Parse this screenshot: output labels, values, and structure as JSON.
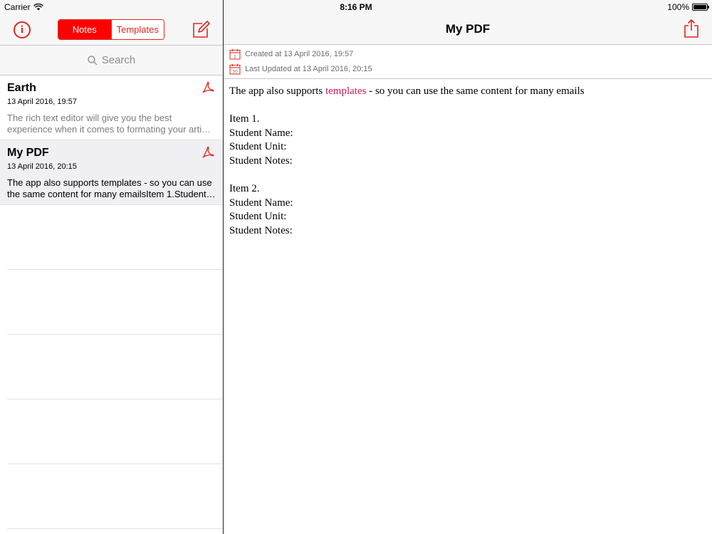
{
  "statusbar": {
    "carrier": "Carrier",
    "time": "8:16 PM",
    "battery": "100%"
  },
  "master": {
    "tabs": [
      {
        "label": "Notes",
        "active": true
      },
      {
        "label": "Templates",
        "active": false
      }
    ],
    "search": {
      "placeholder": "Search"
    },
    "notes": [
      {
        "title": "Earth",
        "date": "13 April 2016, 19:57",
        "preview": "The rich text editor will give you the best experience when it comes to formating your arti…",
        "type_icon": "pdf-icon",
        "selected": false
      },
      {
        "title": "My PDF",
        "date": "13 April 2016, 20:15",
        "preview": "The app also supports templates - so you can use the same content for many emailsItem 1.Student…",
        "type_icon": "pdf-icon",
        "selected": true
      }
    ]
  },
  "detail": {
    "title": "My PDF",
    "created": "Created at 13 April 2016, 19:57",
    "updated": "Last Updated at 13 April 2016, 20:15",
    "content": {
      "intro_before": "The app also supports ",
      "intro_link": "templates",
      "intro_after": " - so you can use the same content for many emails",
      "item1": "Item 1.",
      "item1_name": "Student Name:",
      "item1_unit": "Student Unit:",
      "item1_notes": "Student Notes:",
      "item2": "Item 2.",
      "item2_name": "Student Name:",
      "item2_unit": "Student Unit:",
      "item2_notes": "Student Notes:"
    }
  },
  "colors": {
    "accent": "#e0261e",
    "segment_active": "#ff0000",
    "link": "#d4145a"
  }
}
